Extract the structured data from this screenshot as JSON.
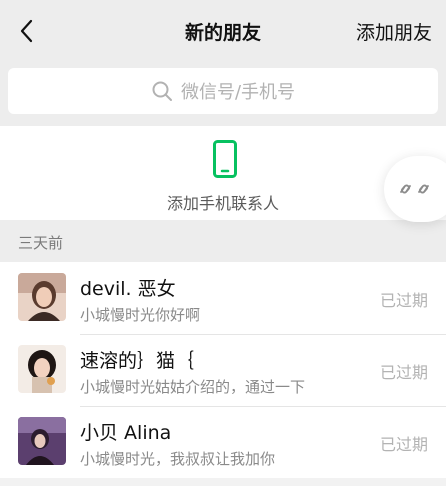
{
  "header": {
    "title": "新的朋友",
    "action_label": "添加朋友",
    "back_icon": "chevron-left-icon"
  },
  "search": {
    "placeholder": "微信号/手机号",
    "icon": "search-icon"
  },
  "add_contacts": {
    "label": "添加手机联系人",
    "icon": "phone-icon",
    "icon_color": "#07c160"
  },
  "floating_button": {
    "icon": "link-icon"
  },
  "section": {
    "label": "三天前"
  },
  "friends": [
    {
      "name": "devil. 恶女",
      "message": "小城慢时光你好啊",
      "status": "已过期",
      "avatar_icon": "avatar-photo"
    },
    {
      "name": "速溶的｝猫｛",
      "message": "小城慢时光姑姑介绍的，通过一下",
      "status": "已过期",
      "avatar_icon": "avatar-photo"
    },
    {
      "name": "小贝 Alina",
      "message": "小城慢时光，我叔叔让我加你",
      "status": "已过期",
      "avatar_icon": "avatar-photo"
    }
  ],
  "colors": {
    "background_gray": "#ededed",
    "accent_green": "#07c160",
    "status_gray": "#b3b3b3"
  }
}
